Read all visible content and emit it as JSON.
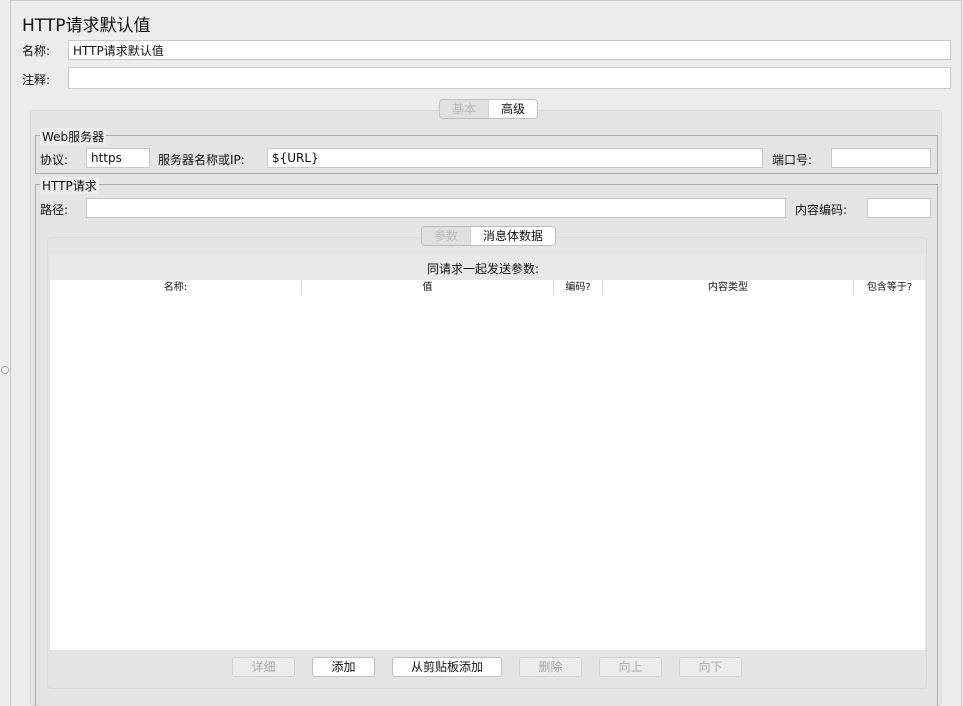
{
  "page": {
    "title": "HTTP请求默认值"
  },
  "name_field": {
    "label": "名称:",
    "value": "HTTP请求默认值"
  },
  "comment_field": {
    "label": "注释:",
    "value": ""
  },
  "main_tabs": {
    "basic": "基本",
    "advanced": "高级",
    "selected": "basic"
  },
  "web_server": {
    "legend": "Web服务器",
    "protocol_label": "协议:",
    "protocol_value": "https",
    "server_label": "服务器名称或IP:",
    "server_value": "${URL}",
    "port_label": "端口号:",
    "port_value": ""
  },
  "http_request": {
    "legend": "HTTP请求",
    "path_label": "路径:",
    "path_value": "",
    "encoding_label": "内容编码:",
    "encoding_value": ""
  },
  "sub_tabs": {
    "params": "参数",
    "body": "消息体数据",
    "selected": "params"
  },
  "params_table": {
    "caption": "同请求一起发送参数:",
    "columns": [
      "名称:",
      "值",
      "编码?",
      "内容类型",
      "包含等于?"
    ],
    "rows": []
  },
  "buttons": {
    "detail": "详细",
    "add": "添加",
    "add_from_clipboard": "从剪贴板添加",
    "delete": "删除",
    "up": "向上",
    "down": "向下"
  }
}
